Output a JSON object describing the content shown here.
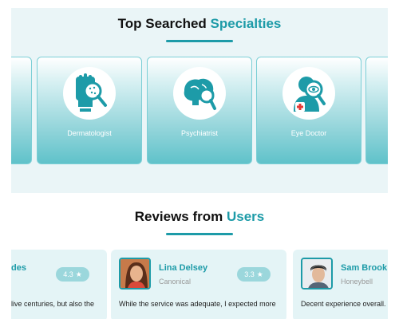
{
  "specialties": {
    "title_part1": "Top Searched",
    "title_part2": "Specialties",
    "items": [
      {
        "label": "",
        "icon": "partial-card"
      },
      {
        "label": "Dermatologist",
        "icon": "skin-magnifier-icon"
      },
      {
        "label": "Psychiatrist",
        "icon": "brain-magnifier-icon"
      },
      {
        "label": "Eye Doctor",
        "icon": "eye-doctor-icon"
      },
      {
        "label": "",
        "icon": "partial-card"
      }
    ]
  },
  "reviews": {
    "title_part1": "Reviews from",
    "title_part2": "Users",
    "items": [
      {
        "name": "des",
        "company": "",
        "rating": "4.3",
        "text": "live centuries, but also the"
      },
      {
        "name": "Lina Delsey",
        "company": "Canonical",
        "rating": "3.3",
        "text": "While the service was adequate, I expected more"
      },
      {
        "name": "Sam Brook",
        "company": "Honeybell",
        "rating": "",
        "text": "Decent experience overall."
      }
    ]
  },
  "colors": {
    "accent": "#1d9ba8",
    "section_bg": "#eaf5f7",
    "card_gradient_bottom": "#5fc2ca"
  }
}
